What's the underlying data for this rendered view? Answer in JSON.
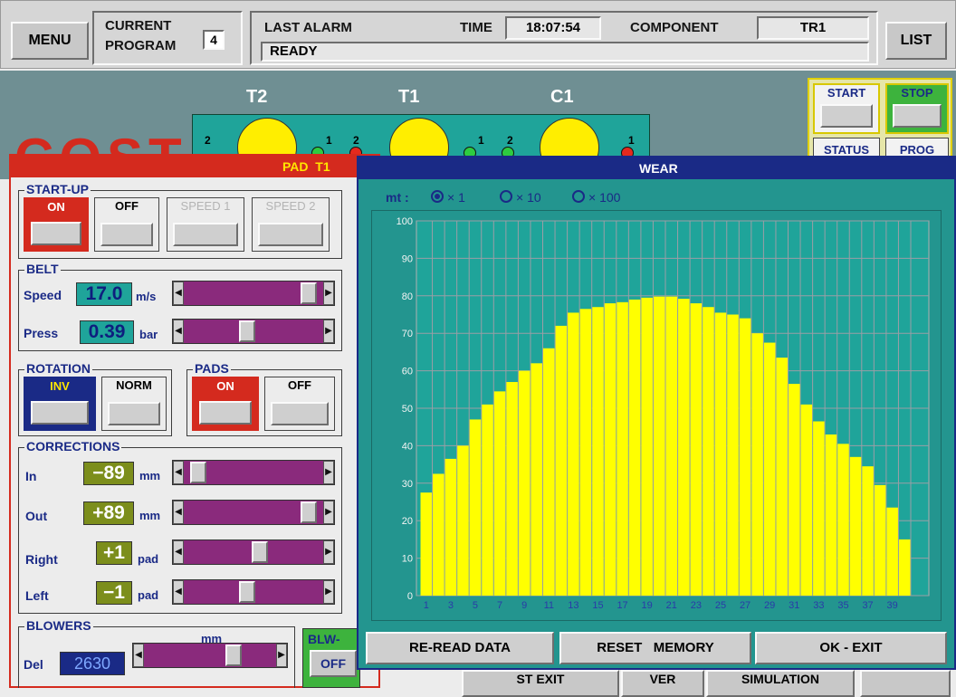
{
  "header": {
    "menu_label": "MENU",
    "current_line1": "CURRENT",
    "current_line2": "PROGRAM",
    "program_number": "4",
    "last_alarm_label": "LAST ALARM",
    "time_label": "TIME",
    "time_value": "18:07:54",
    "component_label": "COMPONENT",
    "component_value": "TR1",
    "status_text": "READY",
    "list_label": "LIST"
  },
  "machine": {
    "stations": [
      "T2",
      "T1",
      "C1"
    ],
    "port_labels": [
      "2",
      "1",
      "2",
      "1",
      "2",
      "1"
    ],
    "colors": {
      "background": "#6f8f93",
      "rail": "#1fa49a",
      "head": "#ffee00"
    }
  },
  "control_panel": {
    "start_label": "START",
    "stop_label": "STOP",
    "status_label": "STATUS",
    "prog_label": "PROG"
  },
  "pad_window": {
    "title": "PAD  T1",
    "startup": {
      "title": "START-UP",
      "buttons": [
        {
          "label": "ON",
          "state": "active"
        },
        {
          "label": "OFF",
          "state": "normal"
        },
        {
          "label": "SPEED 1",
          "state": "disabled"
        },
        {
          "label": "SPEED 2",
          "state": "disabled"
        }
      ]
    },
    "belt": {
      "title": "BELT",
      "speed_label": "Speed",
      "speed_value": "17.0",
      "speed_unit": "m/s",
      "speed_level": 0.95,
      "press_label": "Press",
      "press_value": "0.39",
      "press_unit": "bar",
      "press_level": 0.45
    },
    "rotation": {
      "title": "ROTATION",
      "inv_label": "INV",
      "norm_label": "NORM",
      "selected": "INV"
    },
    "pads": {
      "title": "PADS",
      "on_label": "ON",
      "off_label": "OFF",
      "selected": "ON"
    },
    "corrections": {
      "title": "CORRECTIONS",
      "rows": [
        {
          "label": "In",
          "value": "−89",
          "unit": "mm",
          "level": 0.05
        },
        {
          "label": "Out",
          "value": "+89",
          "unit": "mm",
          "level": 0.95
        },
        {
          "label": "Right",
          "value": "+1",
          "unit": "pad",
          "level": 0.55
        },
        {
          "label": "Left",
          "value": "−1",
          "unit": "pad",
          "level": 0.45
        }
      ]
    },
    "blowers": {
      "title": "BLOWERS",
      "unit_label": "mm",
      "del_label": "Del",
      "del_value": "2630",
      "del_level": 0.7,
      "blw_label": "BLW-",
      "off_label": "OFF"
    }
  },
  "bottom_buttons": [
    "ST  EXIT",
    "VER",
    "SIMULATION"
  ],
  "logo_text": "COSTA",
  "wear_window": {
    "title": "WEAR",
    "mt_label": "mt :",
    "radio_options": [
      {
        "label": "× 1",
        "selected": true
      },
      {
        "label": "× 10",
        "selected": false
      },
      {
        "label": "× 100",
        "selected": false
      }
    ],
    "buttons": [
      "RE-READ DATA",
      "RESET   MEMORY",
      "OK - EXIT"
    ]
  },
  "chart_data": {
    "type": "bar",
    "categories": [
      "1",
      "2",
      "3",
      "4",
      "5",
      "6",
      "7",
      "8",
      "9",
      "10",
      "11",
      "12",
      "13",
      "14",
      "15",
      "16",
      "17",
      "18",
      "19",
      "20",
      "21",
      "22",
      "23",
      "24",
      "25",
      "26",
      "27",
      "28",
      "29",
      "30",
      "31",
      "32",
      "33",
      "34",
      "35",
      "36",
      "37",
      "38",
      "39",
      "40"
    ],
    "x_tick_labels": [
      "1",
      "3",
      "5",
      "7",
      "9",
      "11",
      "13",
      "15",
      "17",
      "19",
      "21",
      "23",
      "25",
      "27",
      "29",
      "31",
      "33",
      "35",
      "37",
      "39"
    ],
    "values": [
      27.5,
      32.5,
      36.5,
      40,
      47,
      51,
      54.5,
      57,
      60,
      62,
      66,
      72,
      75.5,
      76.5,
      77,
      78,
      78.3,
      79,
      79.5,
      79.8,
      79.8,
      79.2,
      78,
      77,
      75.5,
      75,
      74,
      70,
      67.5,
      63.5,
      56.5,
      51,
      46.5,
      43,
      40.5,
      37,
      34.5,
      29.5,
      23.5,
      15
    ],
    "ylim": [
      0,
      100
    ],
    "y_ticks": [
      0,
      10,
      20,
      30,
      40,
      50,
      60,
      70,
      80,
      90,
      100
    ],
    "grid": true,
    "colors": {
      "bar": "#ffff00",
      "background": "#1fa49a",
      "grid": "#9a9ea6",
      "window": "#23958f"
    }
  }
}
